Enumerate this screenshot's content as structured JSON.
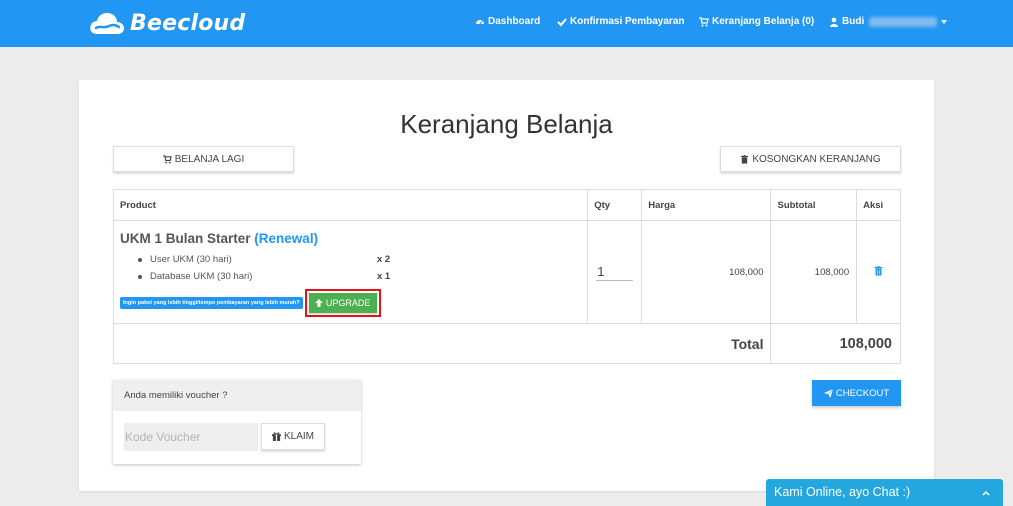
{
  "brand": {
    "name": "Beecloud"
  },
  "nav": {
    "dashboard": "Dashboard",
    "confirm_payment": "Konfirmasi Pembayaran",
    "cart": "Keranjang Belanja (0)",
    "user": "Budi"
  },
  "page": {
    "title": "Keranjang Belanja"
  },
  "actions": {
    "continue_shopping": "BELANJA LAGI",
    "empty_cart": "KOSONGKAN KERANJANG",
    "checkout": "CHECKOUT"
  },
  "table": {
    "headers": {
      "product": "Product",
      "qty": "Qty",
      "price": "Harga",
      "subtotal": "Subtotal",
      "action": "Aksi"
    },
    "items": [
      {
        "name": "UKM 1 Bulan Starter",
        "renewal": "(Renewal)",
        "features": [
          {
            "label": "User UKM (30 hari)",
            "qty": "x 2"
          },
          {
            "label": "Database UKM (30 hari)",
            "qty": "x 1"
          }
        ],
        "upsell_text": "Ingin paket yang lebih tinggi/tempo pembayaran yang lebih murah?",
        "upgrade_label": "UPGRADE",
        "qty": "1",
        "price": "108,000",
        "subtotal": "108,000"
      }
    ],
    "total_label": "Total",
    "total_value": "108,000"
  },
  "voucher": {
    "heading": "Anda memiliki voucher ?",
    "placeholder": "Kode Voucher",
    "claim_label": "KLAIM"
  },
  "chat": {
    "label": "Kami Online, ayo Chat :)"
  },
  "colors": {
    "primary": "#2196f3",
    "success": "#4caf50",
    "highlight_border": "#e2141a",
    "chat": "#24a7de"
  }
}
